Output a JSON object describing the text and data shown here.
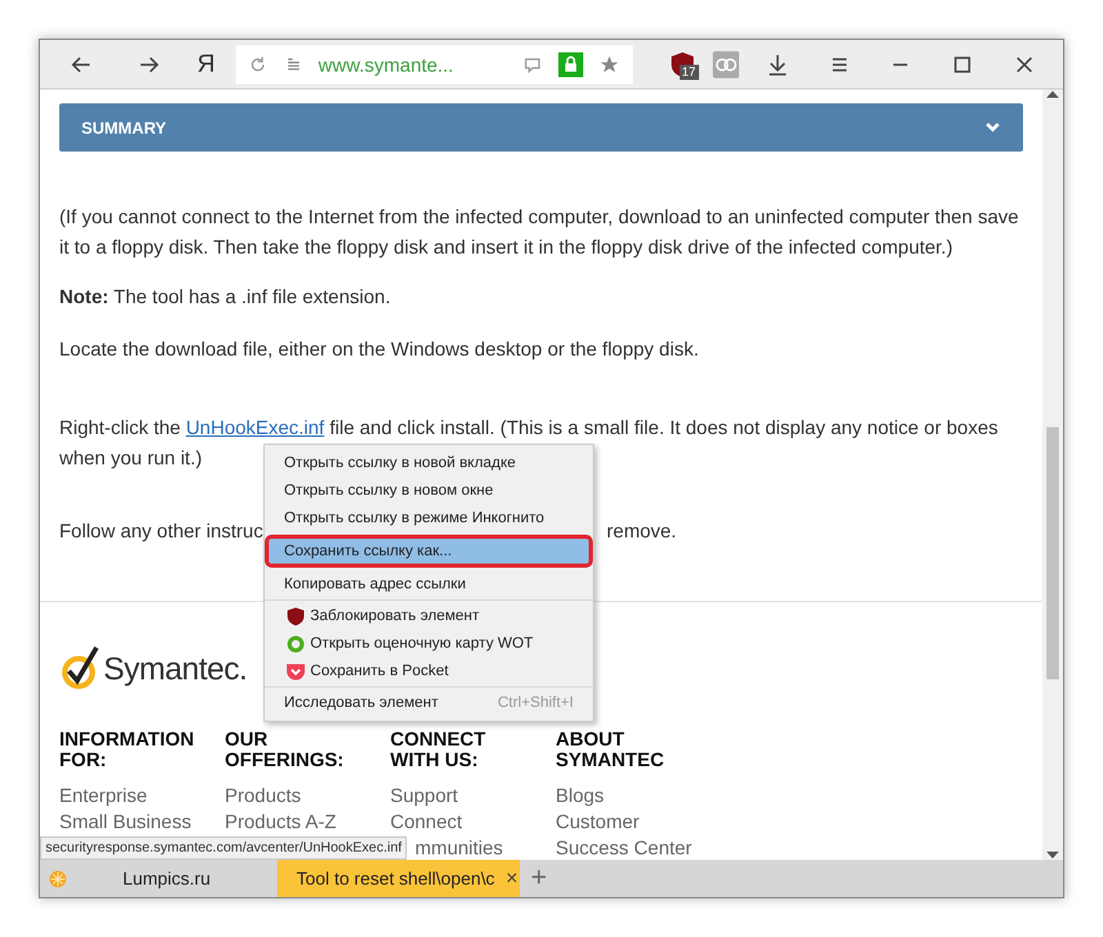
{
  "toolbar": {
    "logo": "Я",
    "address": "www.symante...",
    "extension_badge": "17"
  },
  "summary": {
    "title": "SUMMARY"
  },
  "paragraphs": [
    {
      "kind": "plain",
      "text": "(If you cannot connect to the Internet from the infected computer, download to an uninfected computer then save it to a floppy disk. Then take the floppy disk and insert it in the floppy disk drive of the infected computer.)"
    },
    {
      "kind": "plain",
      "text": "**Note:** The tool has a .inf file extension."
    },
    {
      "kind": "plain",
      "text": "Locate the download file, either on the Windows desktop or the floppy disk."
    },
    {
      "kind": "link",
      "before": "Right-click the ",
      "link": "UnHookExec.inf",
      "after": " file and click install. (This is a small file. It does not display any notice or boxes",
      "line_2": "when you run it.)"
    },
    {
      "kind": "split",
      "left": "Follow any other instruc",
      "right": "remove."
    }
  ],
  "footer": {
    "logo": "Symantec.",
    "columns": [
      {
        "heading": "INFORMATION FOR:",
        "links": [
          "Enterprise",
          "Small Business"
        ]
      },
      {
        "heading": "OUR OFFERINGS:",
        "links": [
          "Products",
          "Products A-Z"
        ]
      },
      {
        "heading": "CONNECT WITH US:",
        "links": [
          "Support",
          "Connect",
          "mmunities"
        ]
      },
      {
        "heading": "ABOUT SYMANTEC",
        "links": [
          "Blogs",
          "Customer",
          "Success Center"
        ]
      }
    ]
  },
  "status_url": "securityresponse.symantec.com/avcenter/UnHookExec.inf",
  "context_menu": {
    "groups": [
      [
        {
          "kind": "plain",
          "label": "Открыть ссылку в новой вкладке",
          "selected": false
        },
        {
          "kind": "plain",
          "label": "Открыть ссылку в новом окне",
          "selected": false
        },
        {
          "kind": "plain",
          "label": "Открыть ссылку в режиме Инкогнито",
          "selected": false
        },
        {
          "kind": "plain",
          "label": "Сохранить ссылку как...",
          "selected": true
        },
        {
          "kind": "plain",
          "label": "Копировать адрес ссылки",
          "selected": false
        }
      ],
      [
        {
          "kind": "shield",
          "label": "Заблокировать элемент",
          "selected": false
        },
        {
          "kind": "ring",
          "label": "Открыть оценочную карту WOT",
          "selected": false
        },
        {
          "kind": "pocket",
          "label": "Сохранить в Pocket",
          "selected": false
        }
      ],
      [
        {
          "kind": "plain",
          "label": "Исследовать элемент",
          "shortcut": "Ctrl+Shift+I",
          "selected": false
        }
      ]
    ]
  },
  "tabs": [
    {
      "title": "Lumpics.ru",
      "selected": false
    },
    {
      "title": "Tool to reset shell\\open\\c",
      "selected": true,
      "close": "×"
    }
  ],
  "new_tab": "+"
}
